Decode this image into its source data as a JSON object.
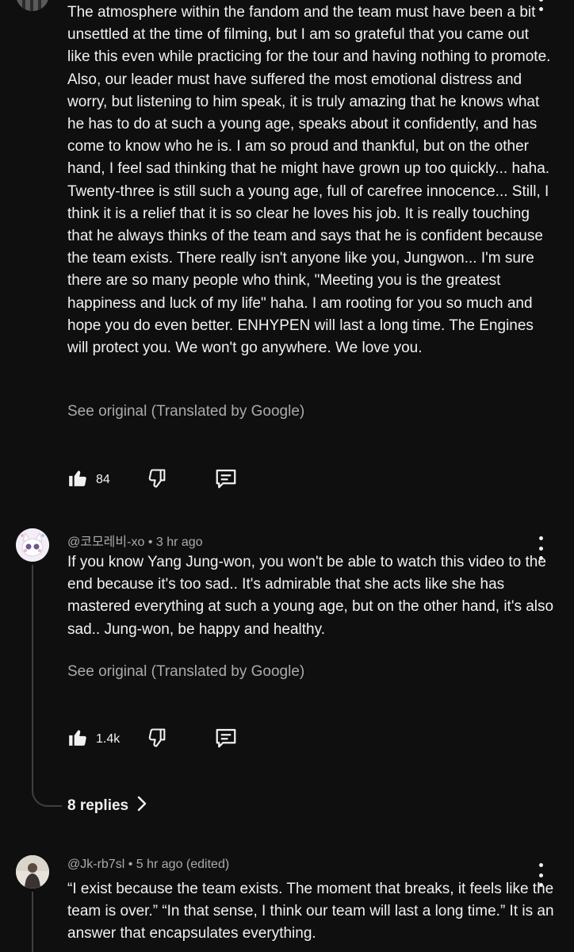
{
  "comments": [
    {
      "body": "The atmosphere within the fandom and the team must have been a bit unsettled at the time of filming, but I am so grateful that you came out like this even while practicing for the tour and having nothing to promote. Also, our leader must have suffered the most emotional distress and worry, but listening to him speak, it is truly amazing that he knows what he has to do at such a young age, speaks about it confidently, and has come to know who he is. I am so proud and thankful, but on the other hand, I feel sad thinking that he might have grown up too quickly... haha. Twenty-three is still such a young age, full of carefree innocence... Still, I think it is a relief that it is so clear he loves his job. It is really touching that he always thinks of the team and says that he is confident because the team exists. There really isn't anyone like you, Jungwon... I'm sure there are so many people who think, \"Meeting you is the greatest happiness and luck of my life\" haha. I am rooting for you so much and hope you do even better. ENHYPEN will last a long time. The Engines will protect you. We won't go anywhere. We love you.",
      "see_original": "See original (Translated by Google)",
      "likes": "84"
    },
    {
      "author": "@코모레비-xo",
      "separator": "•",
      "time": "3 hr ago",
      "body": "If you know Yang Jung-won, you won't be able to watch this video to the end because it's too sad.. It's admirable that she acts like she has mastered everything at such a young age, but on the other hand, it's also sad.. Jung-won, be happy and healthy.",
      "see_original": "See original (Translated by Google)",
      "likes": "1.4k",
      "replies_label": "8 replies"
    },
    {
      "author": "@Jk-rb7sl",
      "separator": "•",
      "time": "5 hr ago (edited)",
      "body": "“I exist because the team exists. The moment that breaks, it feels like the team is over.” “In that sense, I think our team will last a long time.” It is an answer that encapsulates everything."
    }
  ],
  "icons": {
    "like": "thumbs-up-icon",
    "dislike": "thumbs-down-icon",
    "reply": "comment-reply-icon",
    "more": "kebab-menu-icon",
    "chevron": "chevron-right-icon"
  },
  "colors": {
    "background": "#0f0f0f",
    "text": "#f1f1f1",
    "muted": "#aaaaaa",
    "thread_line": "#3f3f3f"
  }
}
